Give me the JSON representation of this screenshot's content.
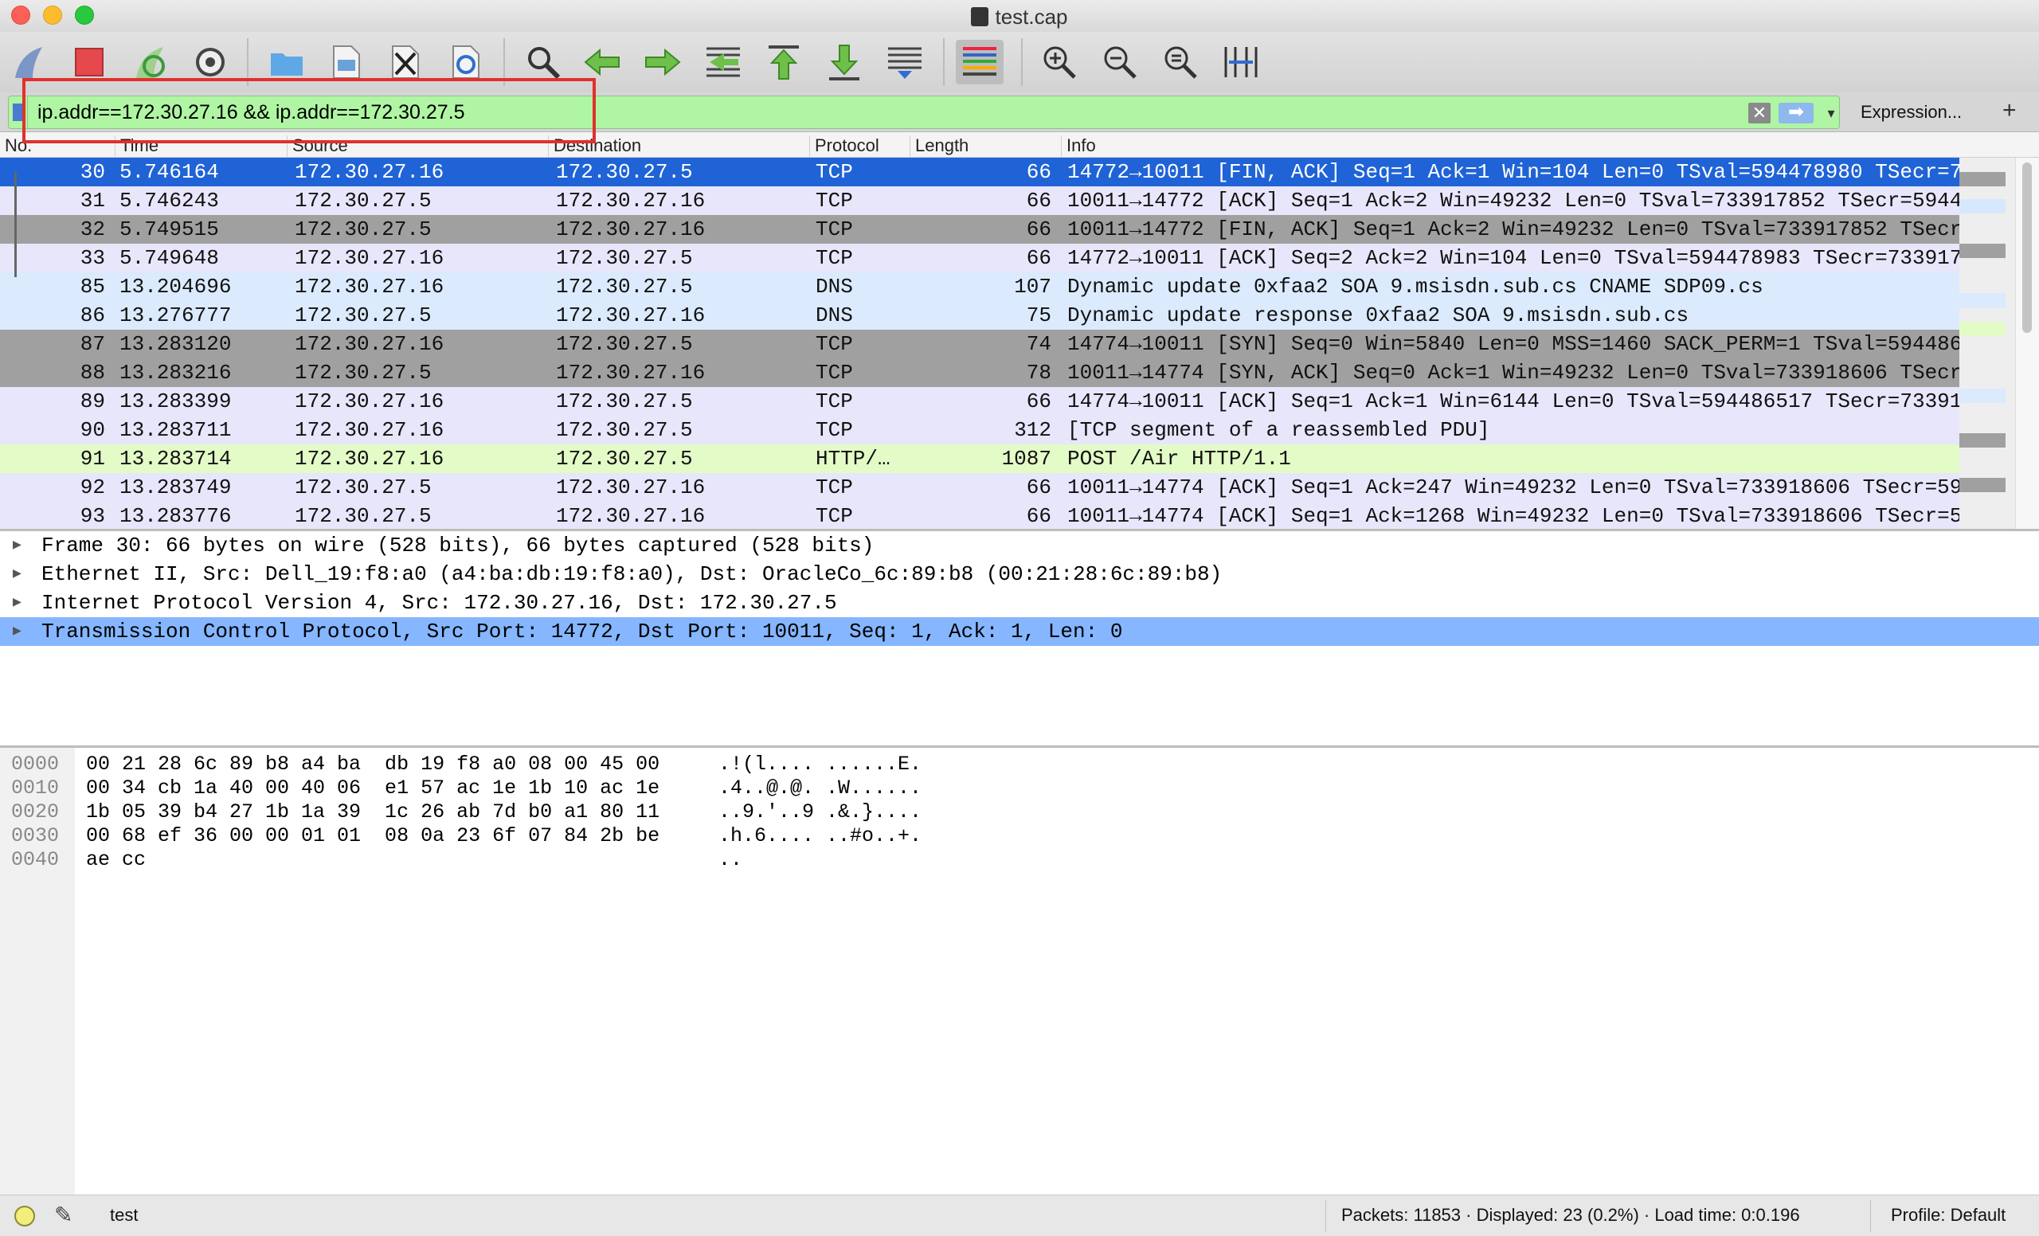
{
  "window": {
    "title": "test.cap"
  },
  "toolbar": {
    "buttons": [
      "start-capture-icon",
      "stop-capture-icon",
      "restart-capture-icon",
      "capture-options-icon",
      "open-file-icon",
      "save-file-icon",
      "close-file-icon",
      "reload-file-icon",
      "find-packet-icon",
      "go-back-icon",
      "go-forward-icon",
      "go-to-packet-icon",
      "go-first-icon",
      "go-last-icon",
      "autoscroll-icon",
      "colorize-icon",
      "zoom-in-icon",
      "zoom-out-icon",
      "zoom-normal-icon",
      "resize-columns-icon"
    ]
  },
  "filter": {
    "value": "ip.addr==172.30.27.16 && ip.addr==172.30.27.5",
    "expression_label": "Expression...",
    "plus": "+",
    "clear": "✕"
  },
  "columns": {
    "no": "No.",
    "time": "Time",
    "source": "Source",
    "destination": "Destination",
    "protocol": "Protocol",
    "length": "Length",
    "info": "Info"
  },
  "packets": [
    {
      "no": "30",
      "time": "5.746164",
      "src": "172.30.27.16",
      "dst": "172.30.27.5",
      "proto": "TCP",
      "len": "66",
      "info": "14772→10011 [FIN, ACK] Seq=1 Ack=1 Win=104 Len=0 TSval=594478980 TSecr=7",
      "bg": "#1f63d6",
      "fg": "#ffffff"
    },
    {
      "no": "31",
      "time": "5.746243",
      "src": "172.30.27.5",
      "dst": "172.30.27.16",
      "proto": "TCP",
      "len": "66",
      "info": "10011→14772 [ACK] Seq=1 Ack=2 Win=49232 Len=0 TSval=733917852 TSecr=5944",
      "bg": "#e8e6fb",
      "fg": "#111111"
    },
    {
      "no": "32",
      "time": "5.749515",
      "src": "172.30.27.5",
      "dst": "172.30.27.16",
      "proto": "TCP",
      "len": "66",
      "info": "10011→14772 [FIN, ACK] Seq=1 Ack=2 Win=49232 Len=0 TSval=733917852 TSecr",
      "bg": "#a0a0a0",
      "fg": "#111111"
    },
    {
      "no": "33",
      "time": "5.749648",
      "src": "172.30.27.16",
      "dst": "172.30.27.5",
      "proto": "TCP",
      "len": "66",
      "info": "14772→10011 [ACK] Seq=2 Ack=2 Win=104 Len=0 TSval=594478983 TSecr=733917",
      "bg": "#e8e6fb",
      "fg": "#111111"
    },
    {
      "no": "85",
      "time": "13.204696",
      "src": "172.30.27.16",
      "dst": "172.30.27.5",
      "proto": "DNS",
      "len": "107",
      "info": "Dynamic update 0xfaa2 SOA 9.msisdn.sub.cs CNAME SDP09.cs",
      "bg": "#dbeafd",
      "fg": "#111111"
    },
    {
      "no": "86",
      "time": "13.276777",
      "src": "172.30.27.5",
      "dst": "172.30.27.16",
      "proto": "DNS",
      "len": "75",
      "info": "Dynamic update response 0xfaa2 SOA 9.msisdn.sub.cs",
      "bg": "#dbeafd",
      "fg": "#111111"
    },
    {
      "no": "87",
      "time": "13.283120",
      "src": "172.30.27.16",
      "dst": "172.30.27.5",
      "proto": "TCP",
      "len": "74",
      "info": "14774→10011 [SYN] Seq=0 Win=5840 Len=0 MSS=1460 SACK_PERM=1 TSval=594486",
      "bg": "#a0a0a0",
      "fg": "#111111"
    },
    {
      "no": "88",
      "time": "13.283216",
      "src": "172.30.27.5",
      "dst": "172.30.27.16",
      "proto": "TCP",
      "len": "78",
      "info": "10011→14774 [SYN, ACK] Seq=0 Ack=1 Win=49232 Len=0 TSval=733918606 TSecr",
      "bg": "#a0a0a0",
      "fg": "#111111"
    },
    {
      "no": "89",
      "time": "13.283399",
      "src": "172.30.27.16",
      "dst": "172.30.27.5",
      "proto": "TCP",
      "len": "66",
      "info": "14774→10011 [ACK] Seq=1 Ack=1 Win=6144 Len=0 TSval=594486517 TSecr=73391",
      "bg": "#e8e6fb",
      "fg": "#111111"
    },
    {
      "no": "90",
      "time": "13.283711",
      "src": "172.30.27.16",
      "dst": "172.30.27.5",
      "proto": "TCP",
      "len": "312",
      "info": "[TCP segment of a reassembled PDU]",
      "bg": "#e8e6fb",
      "fg": "#111111"
    },
    {
      "no": "91",
      "time": "13.283714",
      "src": "172.30.27.16",
      "dst": "172.30.27.5",
      "proto": "HTTP/…",
      "len": "1087",
      "info": "POST /Air HTTP/1.1",
      "bg": "#e3fbc6",
      "fg": "#111111"
    },
    {
      "no": "92",
      "time": "13.283749",
      "src": "172.30.27.5",
      "dst": "172.30.27.16",
      "proto": "TCP",
      "len": "66",
      "info": "10011→14774 [ACK] Seq=1 Ack=247 Win=49232 Len=0 TSval=733918606 TSecr=59",
      "bg": "#e8e6fb",
      "fg": "#111111"
    },
    {
      "no": "93",
      "time": "13.283776",
      "src": "172.30.27.5",
      "dst": "172.30.27.16",
      "proto": "TCP",
      "len": "66",
      "info": "10011→14774 [ACK] Seq=1 Ack=1268 Win=49232 Len=0 TSval=733918606 TSecr=5",
      "bg": "#e8e6fb",
      "fg": "#111111"
    }
  ],
  "details": [
    {
      "text": "Frame 30: 66 bytes on wire (528 bits), 66 bytes captured (528 bits)",
      "selected": false
    },
    {
      "text": "Ethernet II, Src: Dell_19:f8:a0 (a4:ba:db:19:f8:a0), Dst: OracleCo_6c:89:b8 (00:21:28:6c:89:b8)",
      "selected": false
    },
    {
      "text": "Internet Protocol Version 4, Src: 172.30.27.16, Dst: 172.30.27.5",
      "selected": false
    },
    {
      "text": "Transmission Control Protocol, Src Port: 14772, Dst Port: 10011, Seq: 1, Ack: 1, Len: 0",
      "selected": true
    }
  ],
  "hex": [
    {
      "off": "0000",
      "bytes": "00 21 28 6c 89 b8 a4 ba  db 19 f8 a0 08 00 45 00",
      "ascii": ".!(l.... ......E."
    },
    {
      "off": "0010",
      "bytes": "00 34 cb 1a 40 00 40 06  e1 57 ac 1e 1b 10 ac 1e",
      "ascii": ".4..@.@. .W......"
    },
    {
      "off": "0020",
      "bytes": "1b 05 39 b4 27 1b 1a 39  1c 26 ab 7d b0 a1 80 11",
      "ascii": "..9.'..9 .&.}...."
    },
    {
      "off": "0030",
      "bytes": "00 68 ef 36 00 00 01 01  08 0a 23 6f 07 84 2b be",
      "ascii": ".h.6.... ..#o..+."
    },
    {
      "off": "0040",
      "bytes": "ae cc",
      "ascii": ".."
    }
  ],
  "status": {
    "profile_name": "test",
    "packets": "Packets: 11853 · Displayed: 23 (0.2%) · Load time: 0:0.196",
    "profile": "Profile: Default"
  },
  "colors": {
    "selected_row": "#1f63d6",
    "tcp_row": "#e8e6fb",
    "dns_row": "#dbeafd",
    "http_row": "#e3fbc6",
    "syn_fin_row": "#a0a0a0",
    "filter_valid": "#aff5a3",
    "highlight_box": "#e0312b"
  }
}
